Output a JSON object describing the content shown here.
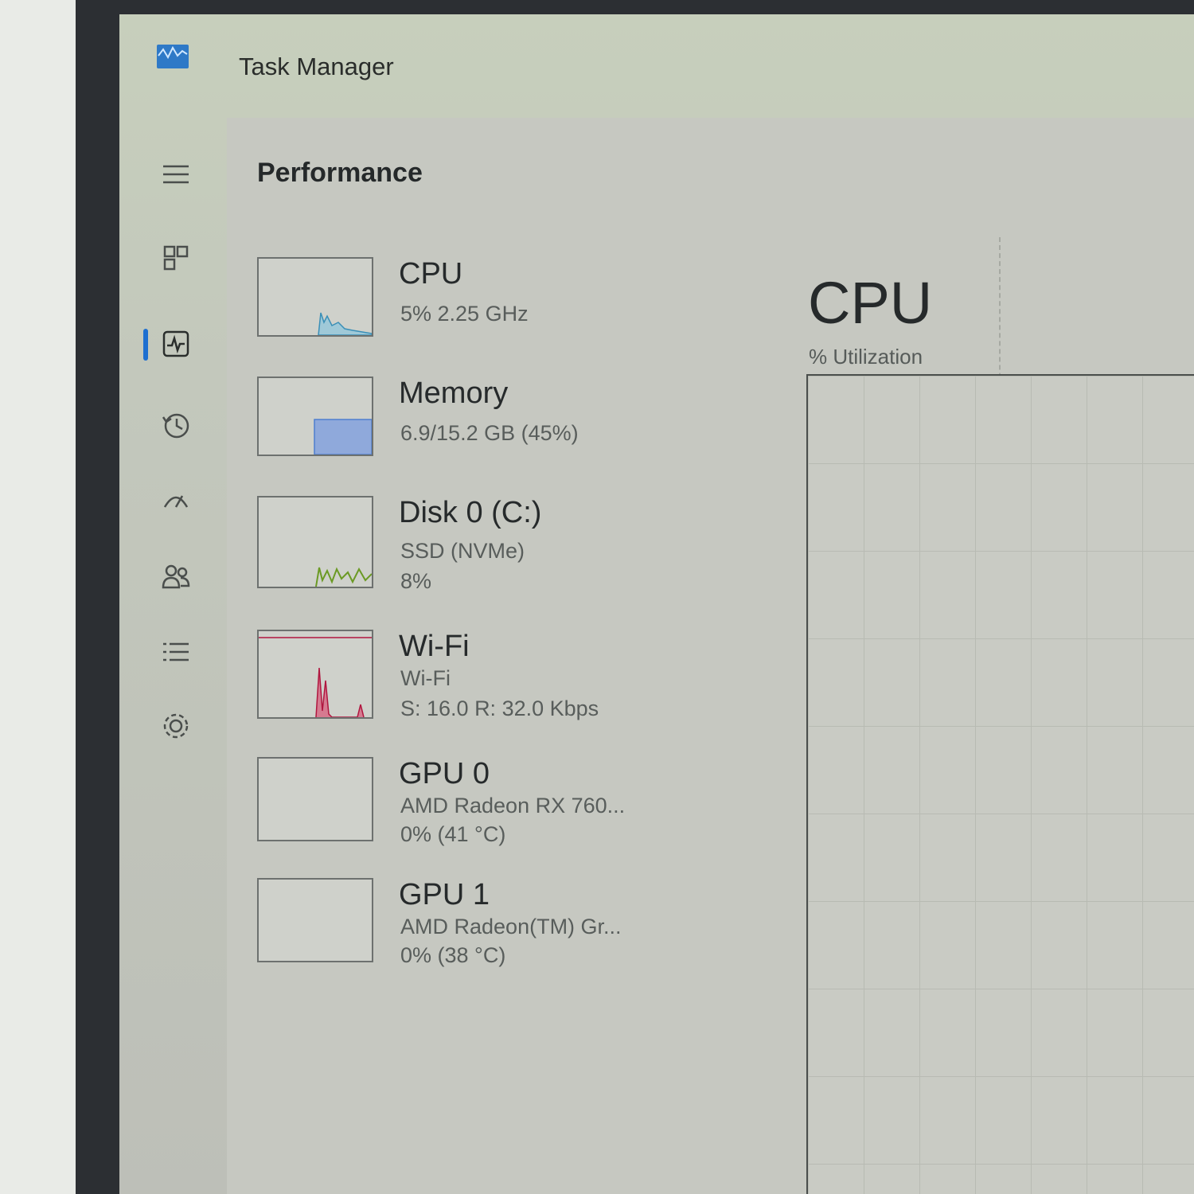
{
  "window": {
    "title": "Task Manager",
    "icon": "task-manager-icon"
  },
  "nav": {
    "items": [
      {
        "name": "hamburger-menu-icon"
      },
      {
        "name": "processes-icon"
      },
      {
        "name": "performance-icon",
        "selected": true
      },
      {
        "name": "app-history-icon"
      },
      {
        "name": "startup-apps-icon"
      },
      {
        "name": "users-icon"
      },
      {
        "name": "details-icon"
      },
      {
        "name": "services-icon"
      }
    ]
  },
  "panel": {
    "title": "Performance"
  },
  "items": [
    {
      "name": "CPU",
      "lines": [
        "5%  2.25 GHz"
      ],
      "color": "#3a8fb7"
    },
    {
      "name": "Memory",
      "lines": [
        "6.9/15.2 GB (45%)"
      ],
      "color": "#4f7fd0"
    },
    {
      "name": "Disk 0 (C:)",
      "lines": [
        "SSD (NVMe)",
        "8%"
      ],
      "color": "#6b9a24"
    },
    {
      "name": "Wi-Fi",
      "lines": [
        "Wi-Fi",
        "S: 16.0  R: 32.0 Kbps"
      ],
      "color": "#b0163f"
    },
    {
      "name": "GPU 0",
      "lines": [
        "AMD Radeon RX 760...",
        "0%  (41 °C)"
      ],
      "color": "#6a6a6a"
    },
    {
      "name": "GPU 1",
      "lines": [
        "AMD Radeon(TM) Gr...",
        "0%  (38 °C)"
      ],
      "color": "#6a6a6a"
    }
  ],
  "detail": {
    "title": "CPU",
    "subtitle": "% Utilization"
  }
}
